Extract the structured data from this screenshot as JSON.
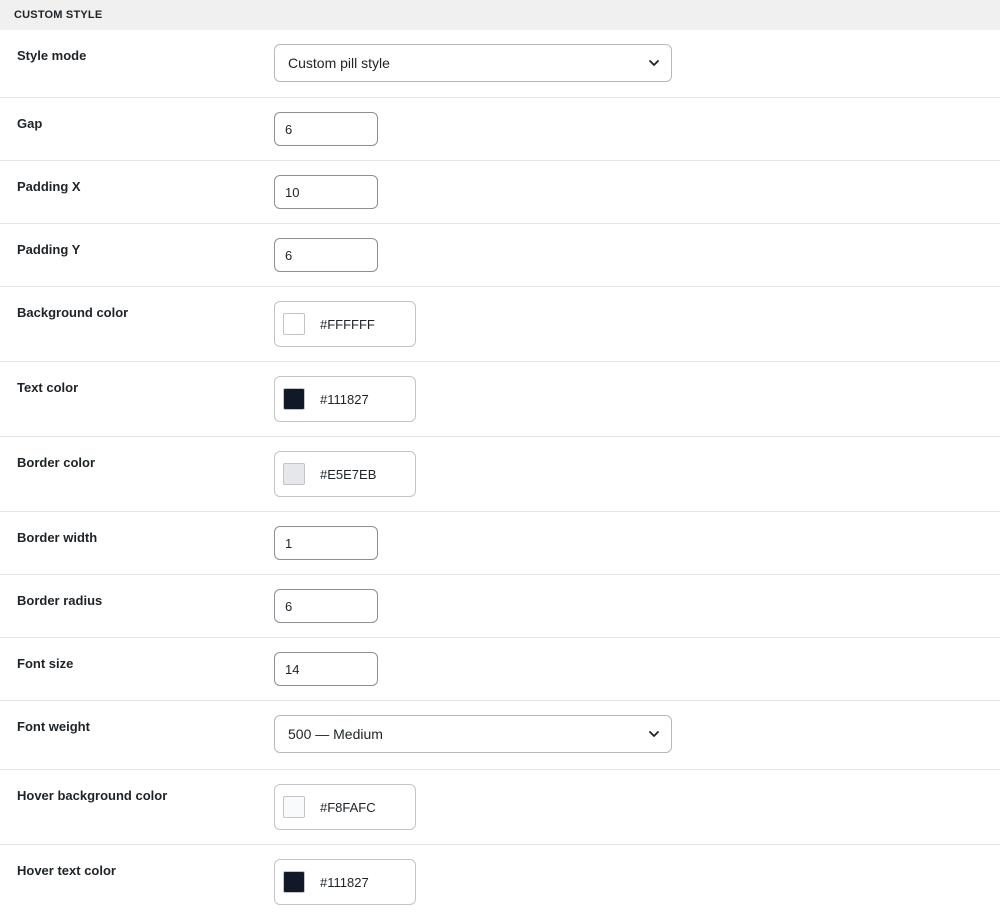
{
  "section": {
    "title": "CUSTOM STYLE"
  },
  "fields": {
    "style_mode": {
      "label": "Style mode",
      "value": "Custom pill style"
    },
    "gap": {
      "label": "Gap",
      "value": "6"
    },
    "padding_x": {
      "label": "Padding X",
      "value": "10"
    },
    "padding_y": {
      "label": "Padding Y",
      "value": "6"
    },
    "background_color": {
      "label": "Background color",
      "value": "#FFFFFF",
      "swatch": "#FFFFFF"
    },
    "text_color": {
      "label": "Text color",
      "value": "#111827",
      "swatch": "#111827"
    },
    "border_color": {
      "label": "Border color",
      "value": "#E5E7EB",
      "swatch": "#E5E7EB"
    },
    "border_width": {
      "label": "Border width",
      "value": "1"
    },
    "border_radius": {
      "label": "Border radius",
      "value": "6"
    },
    "font_size": {
      "label": "Font size",
      "value": "14"
    },
    "font_weight": {
      "label": "Font weight",
      "value": "500 — Medium"
    },
    "hover_background_color": {
      "label": "Hover background color",
      "value": "#F8FAFC",
      "swatch": "#F8FAFC"
    },
    "hover_text_color": {
      "label": "Hover text color",
      "value": "#111827",
      "swatch": "#111827"
    }
  },
  "icons": {
    "select_arrow": "chevron-down-icon"
  }
}
